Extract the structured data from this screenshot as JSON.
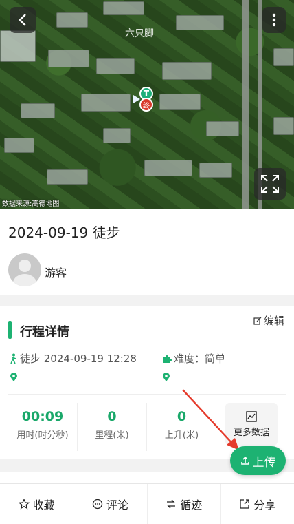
{
  "map": {
    "watermark": "六只脚",
    "source": "数据来源:高德地图",
    "start_marker": "T",
    "end_marker": "终"
  },
  "track": {
    "title": "2024-09-19 徒步",
    "username": "游客"
  },
  "detail": {
    "section_title": "行程详情",
    "edit_label": "编辑",
    "activity": "徒步 2024-09-19 12:28",
    "difficulty": "难度：简单",
    "stats": [
      {
        "value": "00:09",
        "label": "用时(时分秒)"
      },
      {
        "value": "0",
        "label": "里程(米)"
      },
      {
        "value": "0",
        "label": "上升(米)"
      }
    ],
    "more_data_label": "更多数据"
  },
  "upload_label": "上传",
  "bottom_bar": [
    {
      "label": "收藏",
      "icon": "star-icon"
    },
    {
      "label": "评论",
      "icon": "comment-icon"
    },
    {
      "label": "循迹",
      "icon": "trace-icon"
    },
    {
      "label": "分享",
      "icon": "share-icon"
    }
  ],
  "colors": {
    "accent": "#1db272",
    "annotation_arrow": "#e53b2c"
  }
}
